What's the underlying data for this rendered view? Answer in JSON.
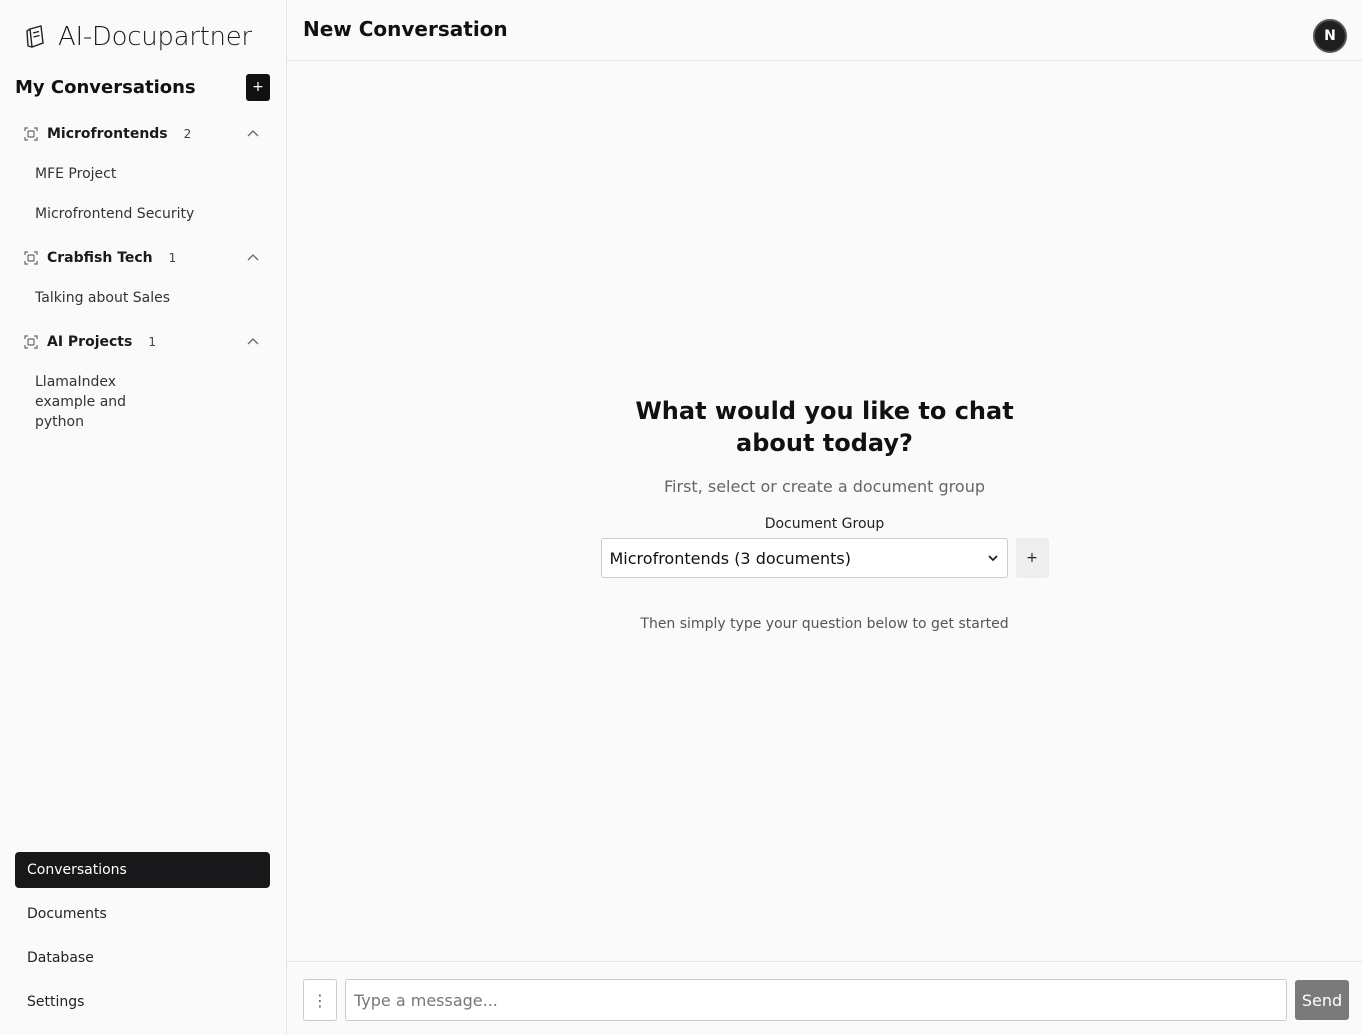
{
  "app": {
    "logo_text": "AI-Docupartner",
    "logo_icon": "book-icon"
  },
  "sidebar": {
    "title": "My Conversations",
    "new_button": "+",
    "groups": [
      {
        "name": "Microfrontends",
        "count": "2",
        "items": [
          "MFE Project",
          "Microfrontend Security"
        ]
      },
      {
        "name": "Crabfish Tech",
        "count": "1",
        "items": [
          "Talking about Sales"
        ]
      },
      {
        "name": "AI Projects",
        "count": "1",
        "items": [
          "LlamaIndex example and python"
        ]
      }
    ],
    "nav": [
      "Conversations",
      "Documents",
      "Database",
      "Settings"
    ],
    "active_nav": "Conversations"
  },
  "header": {
    "title": "New Conversation",
    "avatar_label": "N"
  },
  "welcome": {
    "headline": "What would you like to chat about today?",
    "subline": "First, select or create a document group",
    "group_label": "Document Group",
    "selected_group": "Microfrontends (3 documents)",
    "add_group_button": "+",
    "hint": "Then simply type your question below to get started"
  },
  "composer": {
    "more_button": "⋮",
    "placeholder": "Type a message...",
    "send_label": "Send"
  },
  "colors": {
    "active_nav_bg": "#18181b",
    "send_button_bg": "#7a7a7a",
    "background": "#fafafa"
  }
}
